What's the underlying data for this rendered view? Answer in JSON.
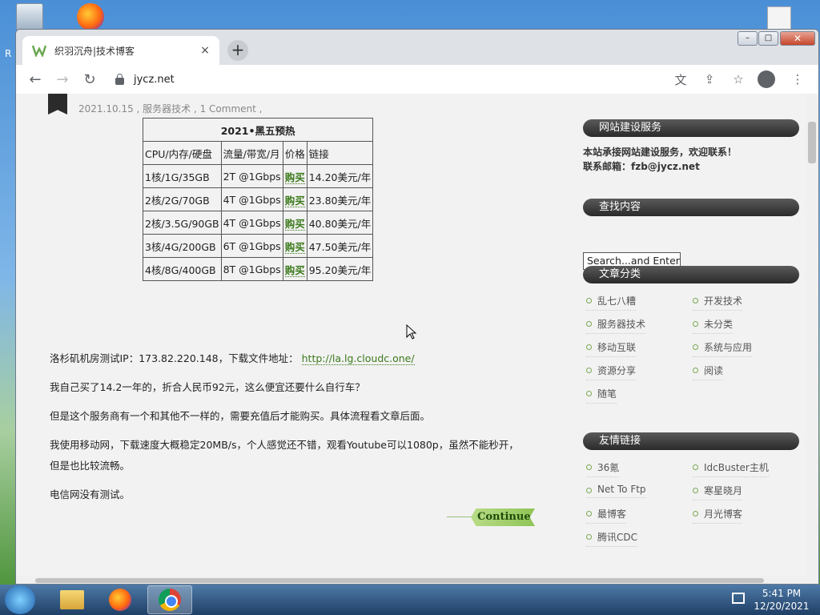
{
  "browser": {
    "tab_title": "织羽沉舟|技术博客",
    "tab_close": "×",
    "new_tab": "+",
    "url": "jycz.net",
    "window_controls": {
      "minimize": "–",
      "maximize": "□",
      "close": "✕"
    }
  },
  "post": {
    "meta": "2021.10.15 , 服务器技术 , 1 Comment ,",
    "table_title": "2021•黑五预热",
    "headers": [
      "CPU/内存/硬盘",
      "流量/带宽/月",
      "价格",
      "链接"
    ],
    "rows": [
      [
        "1核/1G/35GB",
        "2T @1Gbps",
        "购买",
        "14.20美元/年"
      ],
      [
        "2核/2G/70GB",
        "4T @1Gbps",
        "购买",
        "23.80美元/年"
      ],
      [
        "2核/3.5G/90GB",
        "4T @1Gbps",
        "购买",
        "40.80美元/年"
      ],
      [
        "3核/4G/200GB",
        "6T @1Gbps",
        "购买",
        "47.50美元/年"
      ],
      [
        "4核/8G/400GB",
        "8T @1Gbps",
        "购买",
        "95.20美元/年"
      ]
    ],
    "p1_text": "洛杉矶机房测试IP：173.82.220.148，下载文件地址：",
    "p1_link": "http://la.lg.cloudc.one/",
    "p2": "我自己买了14.2一年的，折合人民币92元，这么便宜还要什么自行车？",
    "p3": "但是这个服务商有一个和其他不一样的，需要充值后才能购买。具体流程看文章后面。",
    "p4a": "我使用移动网，下载速度大概稳定20MB/s，个人感觉还不错，观看Youtube可以1080p，虽然不能秒开，",
    "p4b": "但是也比较流畅。",
    "p5": "电信网没有测试。",
    "continue": "Continue"
  },
  "sidebar": {
    "service_title": "网站建设服务",
    "service_line1": "本站承接网站建设服务，欢迎联系！",
    "service_line2": "联系邮箱：fzb@jycz.net",
    "search_title": "查找内容",
    "search_value": "Search...and Enter",
    "categories_title": "文章分类",
    "categories": [
      "乱七八糟",
      "开发技术",
      "服务器技术",
      "未分类",
      "移动互联",
      "系统与应用",
      "资源分享",
      "阅读",
      "随笔"
    ],
    "links_title": "友情链接",
    "links": [
      "36氪",
      "IdcBuster主机",
      "Net To Ftp",
      "寒星晓月",
      "最博客",
      "月光博客",
      "腾讯CDC"
    ]
  },
  "taskbar": {
    "time": "5:41 PM",
    "date": "12/20/2021"
  },
  "desktop": {
    "recycle_label": "R"
  }
}
